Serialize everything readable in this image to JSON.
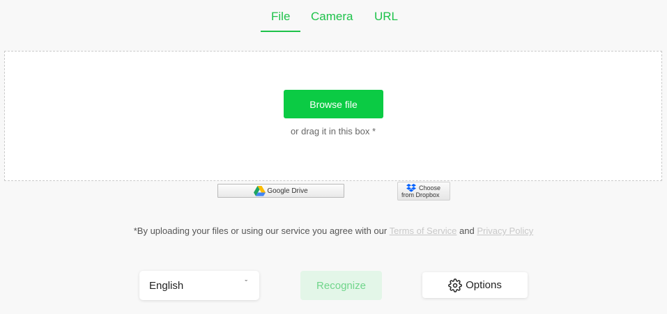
{
  "tabs": [
    {
      "label": "File",
      "active": true
    },
    {
      "label": "Camera",
      "active": false
    },
    {
      "label": "URL",
      "active": false
    }
  ],
  "upload": {
    "browse_label": "Browse file",
    "drag_hint": "or drag it in this box *"
  },
  "cloud": {
    "google_drive_label": "Google Drive",
    "dropbox_line1": "Choose",
    "dropbox_line2": "from Dropbox"
  },
  "terms": {
    "prefix": "*By uploading your files or using our service you agree with our ",
    "terms_link": "Terms of Service",
    "and": " and ",
    "privacy_link": "Privacy Policy"
  },
  "controls": {
    "language_selected": "English",
    "chevron_glyph": "ˇ",
    "recognize_label": "Recognize",
    "options_label": "Options"
  },
  "colors": {
    "accent": "#1ec24a",
    "browse_button": "#0bcb44",
    "recognize_disabled_bg": "#e3f6e8",
    "recognize_disabled_text": "#6fd58a",
    "link_muted": "#c8c8c8"
  },
  "icons": {
    "google_drive": "google-drive-icon",
    "dropbox": "dropbox-icon",
    "options": "gear-icon",
    "language": "chevron-down-icon"
  }
}
